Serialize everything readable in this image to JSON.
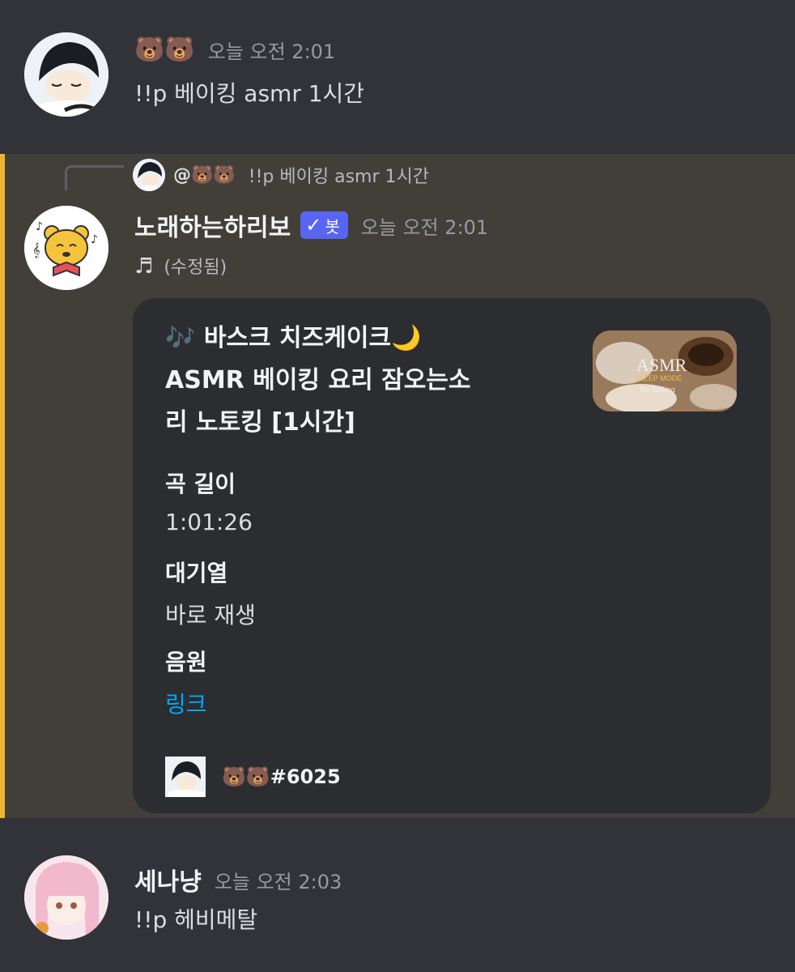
{
  "messages": [
    {
      "author": "🐻🐻",
      "timestamp": "오늘 오전 2:01",
      "content": "!!p 베이킹 asmr 1시간"
    },
    {
      "reply": {
        "mention": "@🐻🐻",
        "content": "!!p 베이킹 asmr 1시간"
      },
      "author": "노래하는하리보",
      "bot_tag": "봇",
      "timestamp": "오늘 오전 2:01",
      "content_icon": "♬",
      "edited": "(수정됨)",
      "embed": {
        "title_emoji": "🎶",
        "title_line1": "바스크 치즈케이크🌙",
        "title_line2": "ASMR 베이킹 요리 잠오는소",
        "title_line3": "리 노토킹 [1시간]",
        "thumbnail_text": "ASMR",
        "thumbnail_sub": "SLEEP MODE",
        "thumbnail_sub2": "No Talking",
        "fields": [
          {
            "name": "곡 길이",
            "value": "1:01:26"
          },
          {
            "name": "대기열",
            "value": "바로 재생"
          },
          {
            "name": "음원",
            "value": "링크"
          }
        ],
        "footer": "🐻🐻#6025"
      }
    },
    {
      "author": "세나냥",
      "timestamp": "오늘 오전 2:03",
      "content": "!!p 헤비메탈"
    }
  ],
  "colors": {
    "background": "#313338",
    "highlight": "#423f39",
    "highlight_bar": "#f0b232",
    "embed_bg": "#2b2d31",
    "bot_tag": "#5865f2",
    "link": "#00a8fc"
  }
}
